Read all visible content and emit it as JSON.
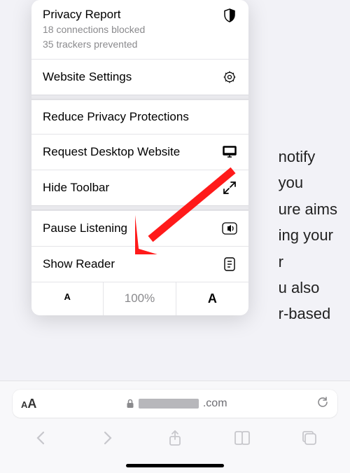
{
  "background": {
    "lines": [
      "notify",
      "  you",
      "ure aims",
      "ing your",
      "r",
      "u also",
      "r-based"
    ]
  },
  "popup": {
    "privacy": {
      "title": "Privacy Report",
      "line1": "18 connections blocked",
      "line2": "35 trackers prevented"
    },
    "websiteSettings": "Website Settings",
    "reducePrivacy": "Reduce Privacy Protections",
    "requestDesktop": "Request Desktop Website",
    "hideToolbar": "Hide Toolbar",
    "pauseListening": "Pause Listening",
    "showReader": "Show Reader",
    "zoom": {
      "smallA": "A",
      "pct": "100%",
      "largeA": "A"
    }
  },
  "urlbar": {
    "aa_small": "A",
    "aa_large": "A",
    "domain_suffix": ".com"
  }
}
